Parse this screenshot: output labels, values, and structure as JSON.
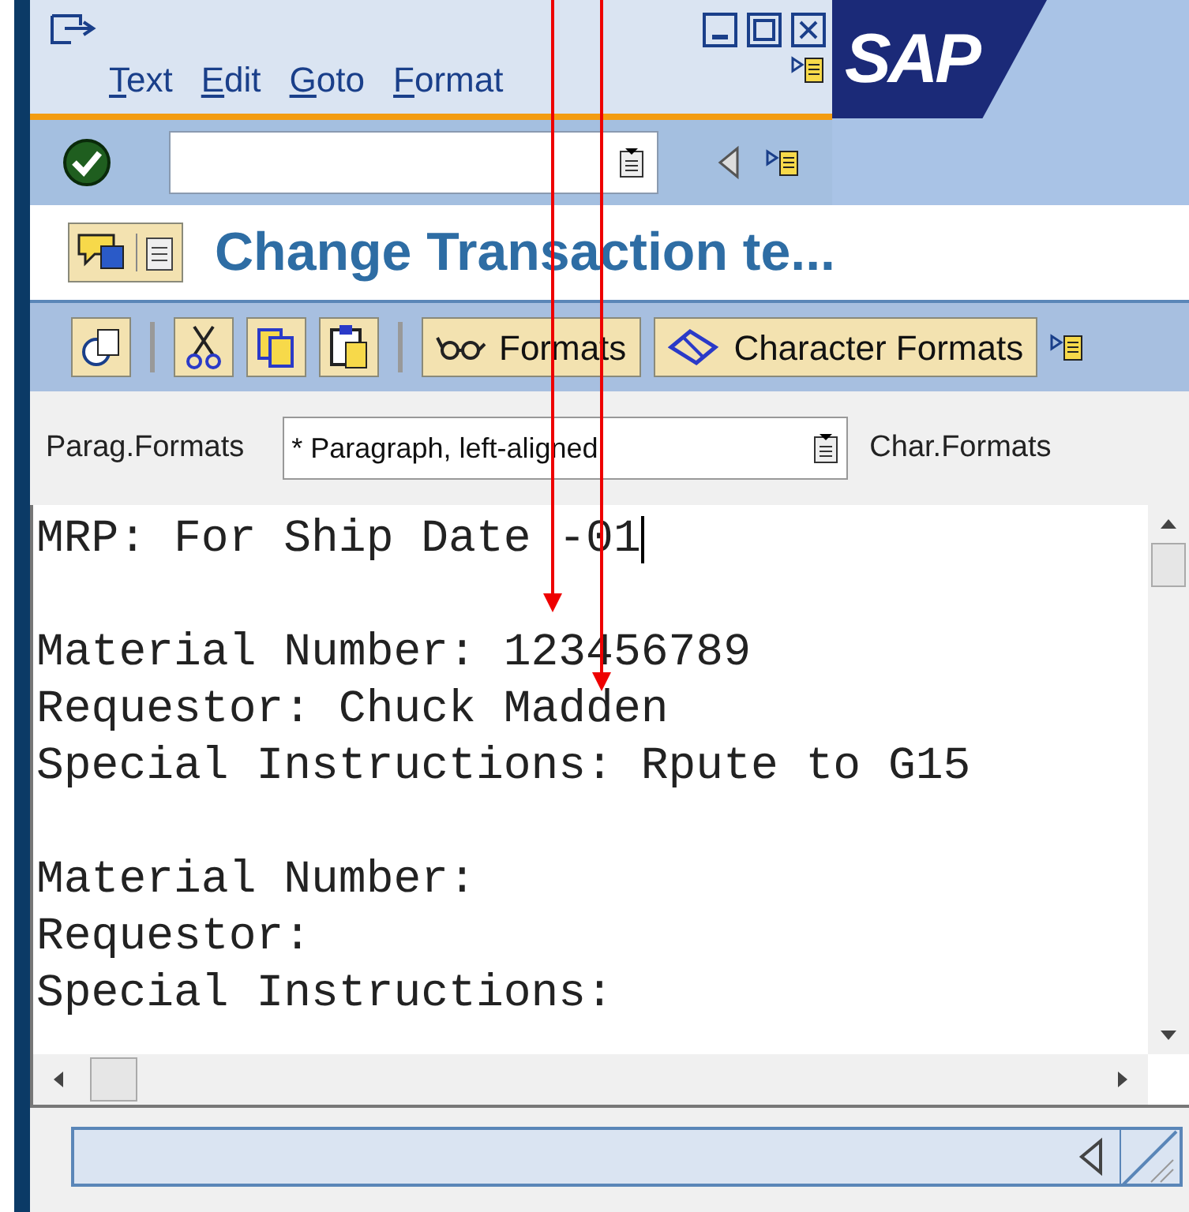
{
  "menu": [
    {
      "label": "Text"
    },
    {
      "label": "Edit"
    },
    {
      "label": "Goto"
    },
    {
      "label": "Format"
    }
  ],
  "logo": {
    "text": "SAP"
  },
  "title": "Change Transaction te...",
  "toolbar": {
    "buttons": [
      {
        "label": "Formats",
        "kind": "glasses"
      },
      {
        "label": "Character Formats",
        "kind": "eraser"
      }
    ]
  },
  "format_row": {
    "paragraph_label": "Parag.Formats",
    "paragraph_value": "* Paragraph, left-aligned",
    "char_label": "Char.Formats"
  },
  "editor": {
    "blocks": [
      [
        {
          "text": "MRP: For Ship Date -01",
          "cursor": true
        }
      ],
      [
        {
          "text": "Material Number: 123456789",
          "cursor": false
        },
        {
          "text": "Requestor: Chuck Madden",
          "cursor": false
        },
        {
          "text": "Special Instructions: Rpute to G15",
          "cursor": false
        }
      ],
      [
        {
          "text": "Material Number:",
          "cursor": false
        },
        {
          "text": "Requestor:",
          "cursor": false
        },
        {
          "text": "Special Instructions:",
          "cursor": false
        }
      ]
    ]
  }
}
